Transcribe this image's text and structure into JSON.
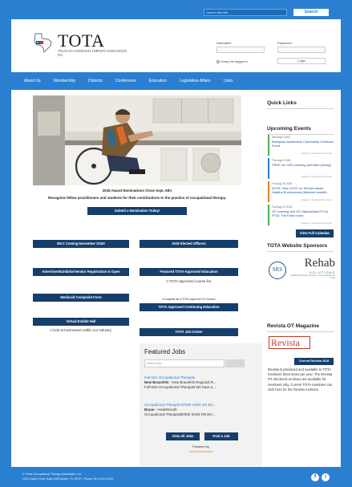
{
  "topbar": {
    "search_placeholder": "Search this site",
    "search_button": "Search"
  },
  "header": {
    "brand": "TOTA",
    "brand_sub": "Texas Occupational Therapy Association, Inc.",
    "login_username_label": "Username",
    "login_password_label": "Password",
    "remember_label": "Keep me logged in",
    "login_button": "Login"
  },
  "nav": [
    "About Us",
    "Membership",
    "Districts",
    "Conference",
    "Education",
    "Legislative Affairs",
    "Links"
  ],
  "main": {
    "hero_caption": "2018 Award Nominations Close Sept. 6th!",
    "hero_subcaption": "Recognize fellow practitioners and students for their contributions to the practice of occupational therapy.",
    "nomination_button": "Submit a Nomination Today!",
    "mcc_button": "MCC Coming November 2019!",
    "elected_button": "2019 Elected Officers",
    "advertiser_button": "Advertiser/Exhibitor/Vendor Registration is Open",
    "featured_ed_button": "Featured TOTA-Approved Education",
    "featured_ed_note": "A TOTA-approved course list.",
    "medicaid_button": "Medicaid Complaint Form",
    "ce_note": "A complete list of TOTA-Approved CE Courses",
    "ce_button": "TOTA Approved Continuing Education",
    "exhibit_button": "Virtual Exhibit Hall",
    "exhibit_note": "A look at businesses within our industry.",
    "jobcenter_button": "TOTA Job Center"
  },
  "featured_jobs": {
    "title": "Featured Jobs",
    "search_placeholder": "Search jobs",
    "jobs": [
      {
        "title": "Full-time Occupational Therapist",
        "company": "New Braunfels",
        "company_rest": " - New Braunfels Regional R...",
        "desc": "Full-time Occupational Therapist We have a ..."
      },
      {
        "title": "Occupational Therapist $7500 SIGN ON BO...",
        "company": "Bryan",
        "company_rest": " - HealthSouth",
        "desc": "Occupational Therapist$7500 SIGN ON BO..."
      }
    ],
    "view_all": "View All Jobs",
    "post_job": "Post a Job",
    "powered_by": "Powered by",
    "powered_brand": "YourMembership"
  },
  "sidebar": {
    "quick_links": "Quick Links",
    "upcoming": "Upcoming Events",
    "events": [
      {
        "date": "Sat Aug 4 2018",
        "title": "Backpack Awareness Community Outreach Event",
        "cat": "Category: Texas Events Center",
        "color": "#4caf50"
      },
      {
        "date": "Thu Aug 9 2018",
        "title": "FREE 1hr CEU meeting (member pricing)",
        "cat": "Category: Texas Events Center",
        "color": "#2a7fd0"
      },
      {
        "date": "Thu Aug 16 2018",
        "title": "AOTA: Now, #TOT on Sensor-based Healthy Environment (Member benefit)",
        "cat": "Category: Texas Events Center",
        "color": "#e67e22"
      },
      {
        "date": "Tue Aug 21 2018",
        "title": "OC meeting and OC Manual/last OT for PT&I: The Extra hours",
        "cat": "Category: Texas Events Center",
        "color": "#4caf50"
      }
    ],
    "full_calendar": "View Full Calendar",
    "sponsors": "TOTA Website Sponsors",
    "sponsor_a": "SRS",
    "sponsor_b": "Rehab",
    "sponsor_b_sub": "SOLUTIONS",
    "sponsor_b_tag": "Leading the best in recovery - every practice is a home",
    "magazine": "Revista OT Magazine",
    "revista": "Revista",
    "current_button": "Current Revista 2018",
    "magazine_text": "Revista is produced and available to TOTA members three times per year. The Revista OT electronic archives are available for members only. Current TOTA members can click here for the Revista Archives."
  },
  "footer": {
    "line1": "© Texas Occupational Therapy Association, Inc.",
    "line2": "1204 Cotton Gene Suite 2008 Austin, TX 78727 | Phone: 512-XXX-XXXX"
  },
  "colors": {
    "brand_blue": "#2a7fd0",
    "button_navy": "#163e6a",
    "texas_red": "#c0392b"
  },
  "icons": [
    "texas-flag-logo-icon",
    "facebook-icon",
    "twitter-icon"
  ]
}
